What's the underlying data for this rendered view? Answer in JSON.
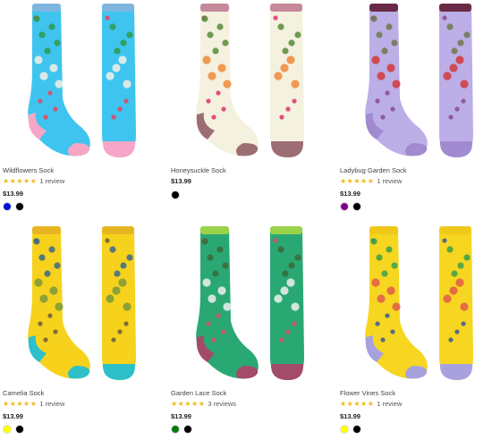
{
  "products": [
    {
      "name": "Wildflowers Sock",
      "stars": "★★★★★",
      "reviews": "1 review",
      "price": "$13.99",
      "swatches": [
        "#0010d8",
        "#000000"
      ],
      "sock_color": "#3ec4ef",
      "heel_color": "#f6a6c6",
      "cuff_color": "#7fb6e0",
      "flower_colors": [
        "#e8435e",
        "#2e9a4a",
        "#f4f0e6"
      ]
    },
    {
      "name": "Honeysuckle Sock",
      "stars": "",
      "reviews": "",
      "price": "$13.99",
      "swatches": [
        "#000000"
      ],
      "sock_color": "#f4f1df",
      "heel_color": "#9c6e73",
      "cuff_color": "#c6899a",
      "flower_colors": [
        "#e0306d",
        "#5a8a3c",
        "#f08a3a"
      ]
    },
    {
      "name": "Ladybug Garden Sock",
      "stars": "★★★★★",
      "reviews": "1 review",
      "price": "$13.99",
      "swatches": [
        "#820088",
        "#000000"
      ],
      "sock_color": "#bcaee6",
      "heel_color": "#a08bd0",
      "cuff_color": "#6a2a46",
      "flower_colors": [
        "#8a4a8c",
        "#6c7a4a",
        "#d23a3a"
      ]
    },
    {
      "name": "Camelia Sock",
      "stars": "★★★★★",
      "reviews": "1 review",
      "price": "$13.99",
      "swatches": [
        "#ffff00",
        "#000000"
      ],
      "sock_color": "#f7d21c",
      "heel_color": "#2ec0c8",
      "cuff_color": "#e8b522",
      "flower_colors": [
        "#6a5a3a",
        "#3a6a8a",
        "#7a9a3a"
      ]
    },
    {
      "name": "Garden Lace Sock",
      "stars": "★★★★★",
      "reviews": "3 reviews",
      "price": "$13.99",
      "swatches": [
        "#0a7a12",
        "#000000"
      ],
      "sock_color": "#2aa873",
      "heel_color": "#a24b6a",
      "cuff_color": "#9ad24a",
      "flower_colors": [
        "#e04a6a",
        "#3a6a3a",
        "#f0f0f0"
      ]
    },
    {
      "name": "Flower Vines Sock",
      "stars": "★★★★★",
      "reviews": "1 review",
      "price": "$13.99",
      "swatches": [
        "#ffff00",
        "#000000"
      ],
      "sock_color": "#f6d620",
      "heel_color": "#a7a2de",
      "cuff_color": "#f0c81a",
      "flower_colors": [
        "#3a5a9a",
        "#3aa04a",
        "#e05a4a"
      ]
    }
  ]
}
